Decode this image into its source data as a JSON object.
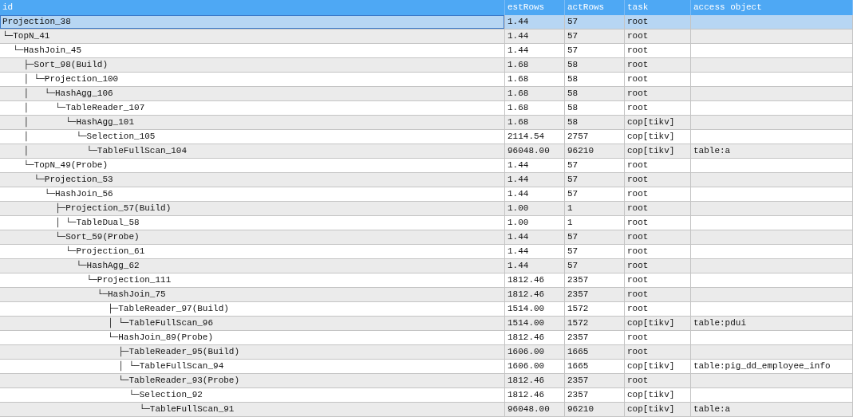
{
  "table": {
    "columns": [
      "id",
      "estRows",
      "actRows",
      "task",
      "access object"
    ],
    "rows": [
      {
        "id": "Projection_38",
        "est_rows": "1.44",
        "act_rows": "57",
        "task": "root",
        "selected": true
      },
      {
        "id": "└─TopN_41",
        "est_rows": "1.44",
        "act_rows": "57",
        "task": "root",
        "selected": false
      },
      {
        "id": "  └─HashJoin_45",
        "est_rows": "1.44",
        "act_rows": "57",
        "task": "root",
        "selected": false
      },
      {
        "id": "    ├─Sort_98(Build)",
        "est_rows": "1.68",
        "act_rows": "58",
        "task": "root",
        "selected": false
      },
      {
        "id": "    │ └─Projection_100",
        "est_rows": "1.68",
        "act_rows": "58",
        "task": "root",
        "selected": false
      },
      {
        "id": "    │   └─HashAgg_106",
        "est_rows": "1.68",
        "act_rows": "58",
        "task": "root",
        "selected": false
      },
      {
        "id": "    │     └─TableReader_107",
        "est_rows": "1.68",
        "act_rows": "58",
        "task": "root",
        "selected": false
      },
      {
        "id": "    │       └─HashAgg_101",
        "est_rows": "1.68",
        "act_rows": "58",
        "task": "cop[tikv]",
        "selected": false
      },
      {
        "id": "    │         └─Selection_105",
        "est_rows": "2114.54",
        "act_rows": "2757",
        "task": "cop[tikv]",
        "selected": false
      },
      {
        "id": "    │           └─TableFullScan_104",
        "est_rows": "96048.00",
        "act_rows": "96210",
        "task": "cop[tikv]",
        "access_object": "table:a",
        "selected": false
      },
      {
        "id": "    └─TopN_49(Probe)",
        "est_rows": "1.44",
        "act_rows": "57",
        "task": "root",
        "selected": false
      },
      {
        "id": "      └─Projection_53",
        "est_rows": "1.44",
        "act_rows": "57",
        "task": "root",
        "selected": false
      },
      {
        "id": "        └─HashJoin_56",
        "est_rows": "1.44",
        "act_rows": "57",
        "task": "root",
        "selected": false
      },
      {
        "id": "          ├─Projection_57(Build)",
        "est_rows": "1.00",
        "act_rows": "1",
        "task": "root",
        "selected": false
      },
      {
        "id": "          │ └─TableDual_58",
        "est_rows": "1.00",
        "act_rows": "1",
        "task": "root",
        "selected": false
      },
      {
        "id": "          └─Sort_59(Probe)",
        "est_rows": "1.44",
        "act_rows": "57",
        "task": "root",
        "selected": false
      },
      {
        "id": "            └─Projection_61",
        "est_rows": "1.44",
        "act_rows": "57",
        "task": "root",
        "selected": false
      },
      {
        "id": "              └─HashAgg_62",
        "est_rows": "1.44",
        "act_rows": "57",
        "task": "root",
        "selected": false
      },
      {
        "id": "                └─Projection_111",
        "est_rows": "1812.46",
        "act_rows": "2357",
        "task": "root",
        "selected": false
      },
      {
        "id": "                  └─HashJoin_75",
        "est_rows": "1812.46",
        "act_rows": "2357",
        "task": "root",
        "selected": false
      },
      {
        "id": "                    ├─TableReader_97(Build)",
        "est_rows": "1514.00",
        "act_rows": "1572",
        "task": "root",
        "selected": false
      },
      {
        "id": "                    │ └─TableFullScan_96",
        "est_rows": "1514.00",
        "act_rows": "1572",
        "task": "cop[tikv]",
        "access_object": "table:pdui",
        "selected": false
      },
      {
        "id": "                    └─HashJoin_89(Probe)",
        "est_rows": "1812.46",
        "act_rows": "2357",
        "task": "root",
        "selected": false
      },
      {
        "id": "                      ├─TableReader_95(Build)",
        "est_rows": "1606.00",
        "act_rows": "1665",
        "task": "root",
        "selected": false
      },
      {
        "id": "                      │ └─TableFullScan_94",
        "est_rows": "1606.00",
        "act_rows": "1665",
        "task": "cop[tikv]",
        "access_object": "table:pig_dd_employee_info",
        "selected": false
      },
      {
        "id": "                      └─TableReader_93(Probe)",
        "est_rows": "1812.46",
        "act_rows": "2357",
        "task": "root",
        "selected": false
      },
      {
        "id": "                        └─Selection_92",
        "est_rows": "1812.46",
        "act_rows": "2357",
        "task": "cop[tikv]",
        "selected": false
      },
      {
        "id": "                          └─TableFullScan_91",
        "est_rows": "96048.00",
        "act_rows": "96210",
        "task": "cop[tikv]",
        "access_object": "table:a",
        "selected": false
      }
    ]
  }
}
